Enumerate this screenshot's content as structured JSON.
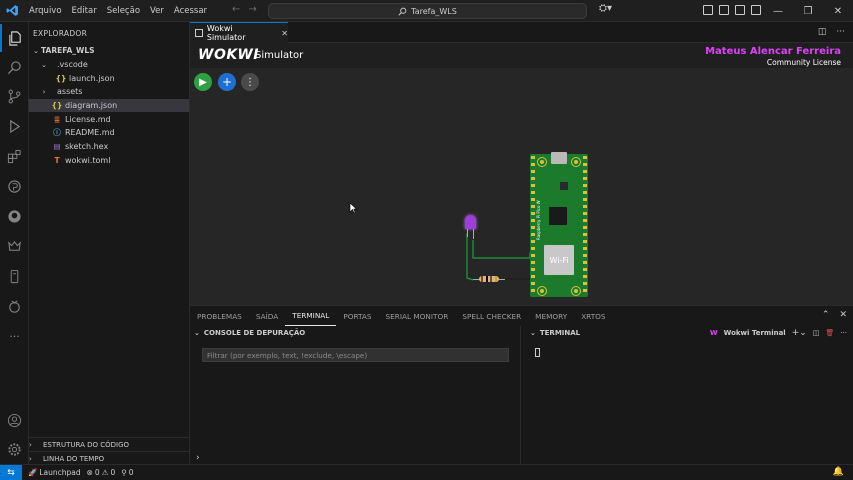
{
  "menu": [
    "Arquivo",
    "Editar",
    "Seleção",
    "Ver",
    "Acessar"
  ],
  "window": {
    "search_text": "Tarefa_WLS"
  },
  "sidebar": {
    "title": "EXPLORADOR",
    "root": "TAREFA_WLS",
    "items": [
      {
        "label": ".vscode",
        "kind": "folder",
        "depth": 1,
        "open": true,
        "icon": ""
      },
      {
        "label": "launch.json",
        "kind": "file",
        "depth": 2,
        "icon": "{}",
        "color": "#cbcb41"
      },
      {
        "label": "assets",
        "kind": "folder",
        "depth": 1,
        "open": false,
        "icon": ""
      },
      {
        "label": "diagram.json",
        "kind": "file",
        "depth": 1,
        "icon": "{}",
        "color": "#cbcb41",
        "selected": true
      },
      {
        "label": "License.md",
        "kind": "file",
        "depth": 1,
        "icon": "≣",
        "color": "#e37933"
      },
      {
        "label": "README.md",
        "kind": "file",
        "depth": 1,
        "icon": "ⓘ",
        "color": "#519aba"
      },
      {
        "label": "sketch.hex",
        "kind": "file",
        "depth": 1,
        "icon": "▤",
        "color": "#a074c4"
      },
      {
        "label": "wokwi.toml",
        "kind": "file",
        "depth": 1,
        "icon": "T",
        "color": "#e37933"
      }
    ],
    "outline": "ESTRUTURA DO CÓDIGO",
    "timeline": "LINHA DO TEMPO"
  },
  "tab": {
    "label": "Wokwi Simulator"
  },
  "wokwi": {
    "logo": "WOKWI",
    "title": "Simulator",
    "license_name": "Mateus Alencar Ferreira",
    "license_type": "Community License",
    "board_chip_text": "Wi-Fi",
    "board_label": "Raspberry Pi Pico W",
    "play_icon": "▶",
    "add_icon": "+",
    "more_icon": "⋮"
  },
  "panel": {
    "tabs": [
      "PROBLEMAS",
      "SAÍDA",
      "TERMINAL",
      "PORTAS",
      "SERIAL MONITOR",
      "SPELL CHECKER",
      "MEMORY",
      "XRTOS"
    ],
    "active_tab": "TERMINAL",
    "debug_title": "CONSOLE DE DEPURAÇÃO",
    "filter_placeholder": "Filtrar (por exemplo, text, !exclude, \\escape)",
    "terminal_title": "TERMINAL",
    "terminal_name": "Wokwi Terminal"
  },
  "status": {
    "launchpad": "Launchpad",
    "errors": "0",
    "warnings": "0",
    "ports": "0"
  },
  "colors": {
    "accent": "#0078d4",
    "license": "#e040fb",
    "board": "#1b7a2c",
    "play": "#2ea043",
    "add": "#1f6fd1"
  }
}
